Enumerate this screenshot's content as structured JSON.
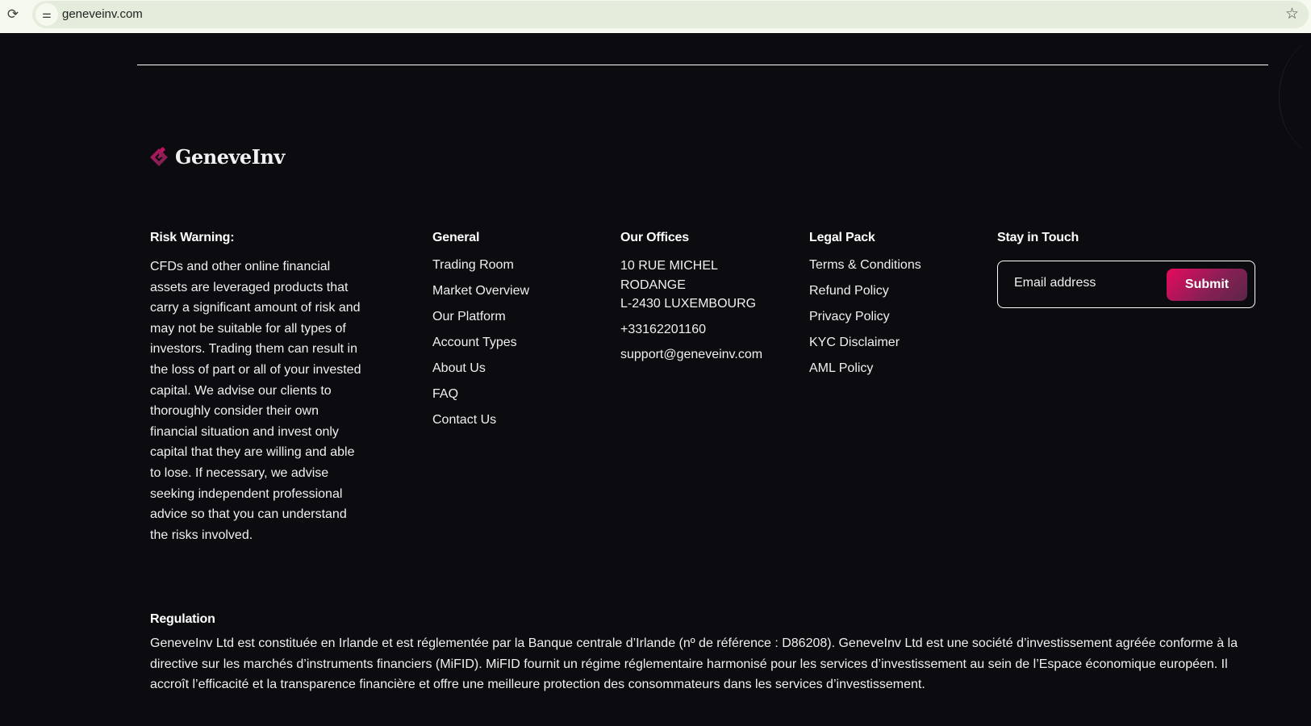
{
  "browser": {
    "url": "geneveinv.com"
  },
  "logo": {
    "name": "GeneveInv"
  },
  "risk": {
    "title": "Risk Warning:",
    "text": "CFDs and other online financial assets are leveraged products that carry a significant amount of risk and may not be suitable for all types of investors. Trading them can result in the loss of part or all of your invested capital. We advise our clients to thoroughly consider their own financial situation and invest only capital that they are willing and able to lose. If necessary, we advise seeking independent professional advice so that you can understand the risks involved."
  },
  "general": {
    "title": "General",
    "items": [
      "Trading Room",
      "Market Overview",
      "Our Platform",
      "Account Types",
      "About Us",
      "FAQ",
      "Contact Us"
    ]
  },
  "offices": {
    "title": "Our Offices",
    "address1": "10 RUE MICHEL",
    "address2": "RODANGE",
    "address3": "L-2430 LUXEMBOURG",
    "phone": "+33162201160",
    "email": "support@geneveinv.com"
  },
  "legal": {
    "title": "Legal Pack",
    "items": [
      "Terms & Conditions",
      "Refund Policy",
      "Privacy Policy",
      "KYC Disclaimer",
      "AML Policy"
    ]
  },
  "newsletter": {
    "title": "Stay in Touch",
    "placeholder": "Email address",
    "submit": "Submit"
  },
  "regulation": {
    "title": "Regulation",
    "text": "GeneveInv Ltd est constituée en Irlande et est réglementée par la Banque centrale d’Irlande (nº de référence : D86208). GeneveInv Ltd est une société d’investissement agréée conforme à la directive sur les marchés d’instruments financiers (MiFID). MiFID fournit un régime réglementaire harmonisé pour les services d’investissement au sein de l’Espace économique européen. Il accroît l’efficacité et la transparence financière et offre une meilleure protection des consommateurs dans les services d’investissement."
  }
}
